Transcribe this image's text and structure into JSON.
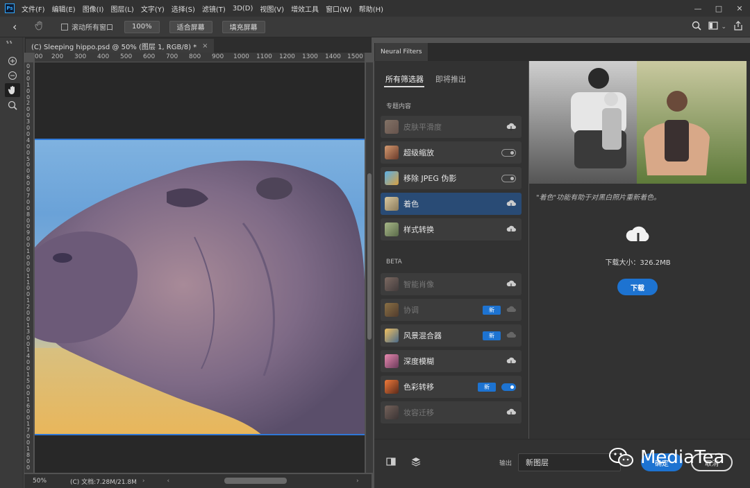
{
  "app": {
    "logo_text": "Ps",
    "menu": [
      "文件(F)",
      "编辑(E)",
      "图像(I)",
      "图层(L)",
      "文字(Y)",
      "选择(S)",
      "滤镜(T)",
      "3D(D)",
      "视图(V)",
      "增效工具",
      "窗口(W)",
      "帮助(H)"
    ]
  },
  "options_bar": {
    "scroll_all_windows": "滚动所有窗口",
    "zoom_100": "100%",
    "fit_screen": "适合屏幕",
    "fill_screen": "填充屏幕"
  },
  "document": {
    "tab_title": "(C) Sleeping hippo.psd @ 50% (图层 1, RGB/8) *",
    "ruler_top": [
      "00",
      "200",
      "300",
      "400",
      "500",
      "600",
      "700",
      "800",
      "900",
      "1000",
      "1100",
      "1200",
      "1300",
      "1400",
      "1500"
    ],
    "ruler_left": [
      "0",
      "0",
      "0",
      "1",
      "0",
      "0",
      "2",
      "0",
      "0",
      "3",
      "0",
      "0",
      "4",
      "0",
      "0",
      "5",
      "0",
      "0",
      "6",
      "0",
      "0",
      "7",
      "0",
      "0",
      "8",
      "0",
      "0",
      "9",
      "0",
      "0",
      "1",
      "0",
      "0",
      "0",
      "1",
      "1",
      "0",
      "0",
      "1",
      "2",
      "0",
      "0",
      "1",
      "3",
      "0",
      "0",
      "1",
      "4",
      "0",
      "0",
      "1",
      "5",
      "0",
      "0",
      "1",
      "6",
      "0",
      "0",
      "1",
      "7",
      "0",
      "0",
      "1",
      "8",
      "0",
      "0"
    ],
    "zoom": "50%",
    "doc_size": "(C) 文档:7.28M/21.8M"
  },
  "neural_filters": {
    "panel_title": "Neural Filters",
    "tabs": [
      "所有筛选器",
      "即将推出"
    ],
    "section_featured": "专题内容",
    "section_beta": "BETA",
    "featured": [
      {
        "label": "皮肤平滑度",
        "state": "cloud",
        "disabled": true,
        "thumb_color": "#c9a38a"
      },
      {
        "label": "超级缩放",
        "state": "toggle-off",
        "disabled": false,
        "thumb_color": "#b5785a"
      },
      {
        "label": "移除 JPEG 伪影",
        "state": "toggle-off",
        "disabled": false,
        "thumb_color": "#3a8fd1"
      },
      {
        "label": "着色",
        "state": "cloud",
        "disabled": false,
        "selected": true,
        "thumb_color": "#b8a684"
      },
      {
        "label": "样式转换",
        "state": "cloud",
        "disabled": false,
        "thumb_color": "#8a9a6a"
      }
    ],
    "beta": [
      {
        "label": "智能肖像",
        "state": "cloud",
        "disabled": true,
        "thumb_color": "#a07a6a"
      },
      {
        "label": "协调",
        "state": "cloud-dim",
        "badge": "新",
        "disabled": true,
        "thumb_color": "#c98a3a"
      },
      {
        "label": "风景混合器",
        "state": "cloud-dim",
        "badge": "新",
        "disabled": false,
        "thumb_color": "#d8a040"
      },
      {
        "label": "深度模糊",
        "state": "cloud",
        "disabled": false,
        "thumb_color": "#c06a8a"
      },
      {
        "label": "色彩转移",
        "state": "toggle-on",
        "badge": "新",
        "disabled": false,
        "thumb_color": "#d05a2a"
      },
      {
        "label": "妆容迁移",
        "state": "cloud",
        "disabled": true,
        "thumb_color": "#8a6a5a"
      }
    ],
    "detail": {
      "description": "\"着色\"功能有助于对黑白照片重新着色。",
      "download_size": "下载大小：326.2MB",
      "download_button": "下载"
    },
    "bottom": {
      "output_label": "输出",
      "output_value": "新图层",
      "ok_button": "确定",
      "cancel_button": "取消"
    }
  },
  "watermark": "MediaTea",
  "colors": {
    "accent": "#1d73d1",
    "selected_row": "#294b75",
    "panel_bg": "#323232"
  }
}
